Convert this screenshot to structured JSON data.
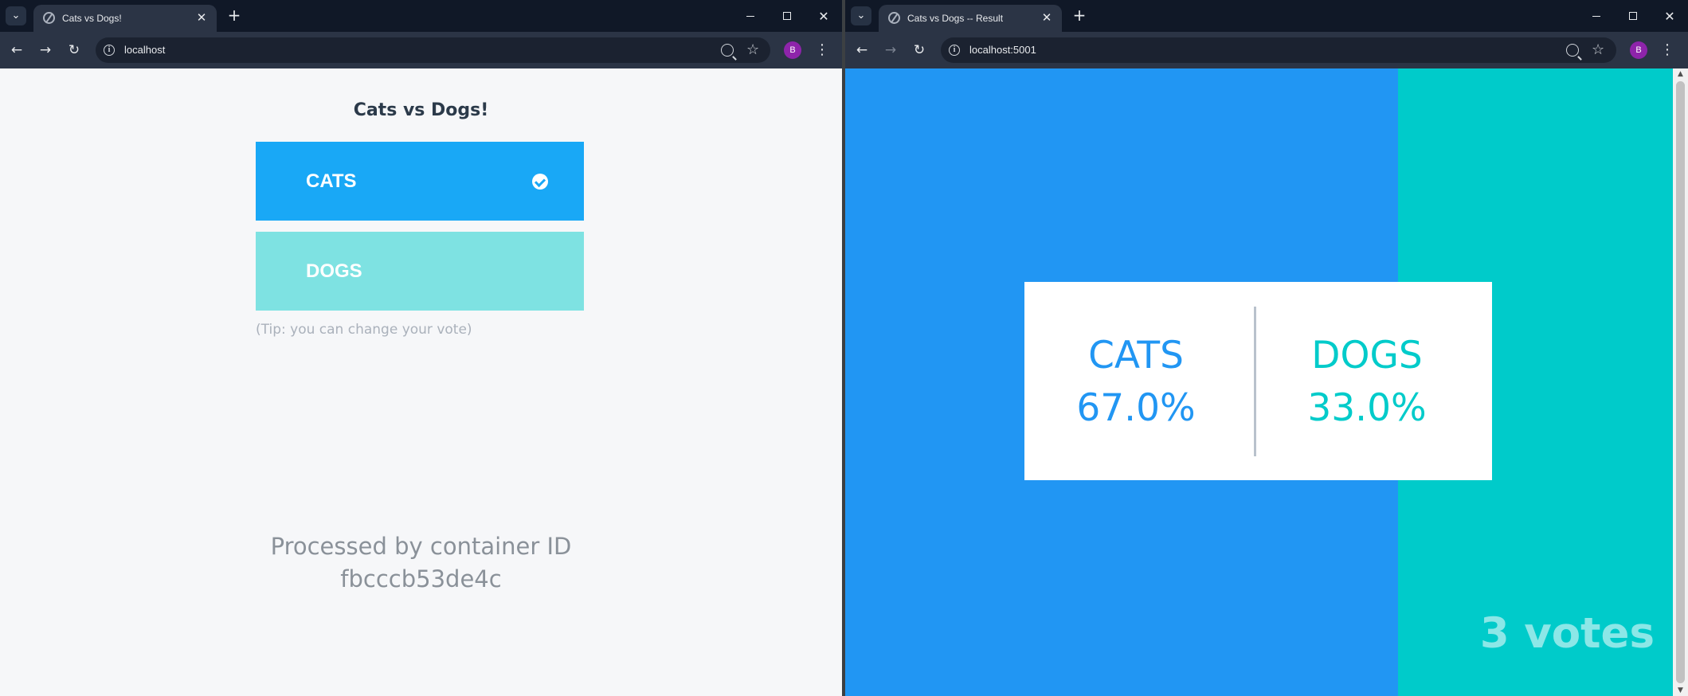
{
  "left_window": {
    "tab_title": "Cats vs Dogs!",
    "url": "localhost",
    "profile_initial": "B",
    "vote": {
      "title": "Cats vs Dogs!",
      "cats_label": "CATS",
      "dogs_label": "DOGS",
      "selected": "CATS",
      "tip": "(Tip: you can change your vote)",
      "processed_line1": "Processed by container ID",
      "container_id": "fbcccb53de4c",
      "cats_color": "#19a8f6",
      "dogs_color": "#7ee2e2"
    }
  },
  "right_window": {
    "tab_title": "Cats vs Dogs -- Result",
    "url": "localhost:5001",
    "profile_initial": "B",
    "result": {
      "cats_label": "CATS",
      "cats_percent": "67.0%",
      "dogs_label": "DOGS",
      "dogs_percent": "33.0%",
      "votes_text": "3 votes",
      "cats_color": "#2196f3",
      "dogs_color": "#00cbca"
    }
  },
  "icons": {
    "tab_menu": "chevron-down-icon",
    "new_tab": "plus-icon",
    "back": "arrow-left-icon",
    "forward": "arrow-right-icon",
    "reload": "reload-icon",
    "site_info": "info-icon",
    "zoom": "zoom-icon",
    "bookmark": "star-icon",
    "menu": "more-vert-icon"
  }
}
